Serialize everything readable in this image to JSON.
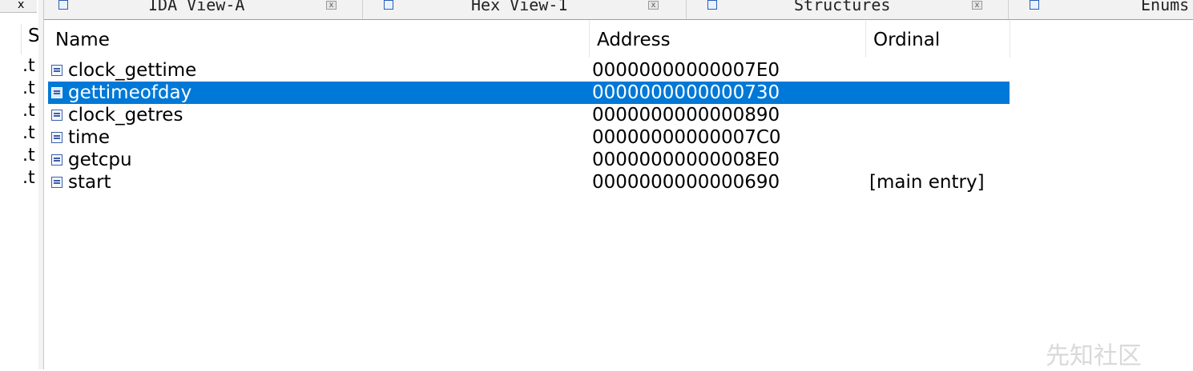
{
  "left_panel": {
    "close_glyph": "x",
    "column_header": "S",
    "rows": [
      ".t",
      ".t",
      ".t",
      ".t",
      ".t",
      ".t"
    ]
  },
  "tabs": [
    {
      "title": "IDA View-A",
      "icon": "disassembly-icon"
    },
    {
      "title": "Hex View-1",
      "icon": "hex-icon"
    },
    {
      "title": "Structures",
      "icon": "structures-icon"
    },
    {
      "title": "Enums",
      "icon": "enums-icon"
    }
  ],
  "tab_close_glyph": "x",
  "columns": {
    "name": "Name",
    "address": "Address",
    "ordinal": "Ordinal"
  },
  "rows": [
    {
      "name": "clock_gettime",
      "address": "00000000000007E0",
      "ordinal": ""
    },
    {
      "name": "gettimeofday",
      "address": "0000000000000730",
      "ordinal": ""
    },
    {
      "name": "clock_getres",
      "address": "0000000000000890",
      "ordinal": ""
    },
    {
      "name": "time",
      "address": "00000000000007C0",
      "ordinal": ""
    },
    {
      "name": "getcpu",
      "address": "00000000000008E0",
      "ordinal": ""
    },
    {
      "name": "start",
      "address": "0000000000000690",
      "ordinal": "[main entry]"
    }
  ],
  "selected_row_index": 1,
  "watermark": "先知社区",
  "colors": {
    "selection": "#0078d7",
    "accent_icon": "#3a5fa8"
  }
}
